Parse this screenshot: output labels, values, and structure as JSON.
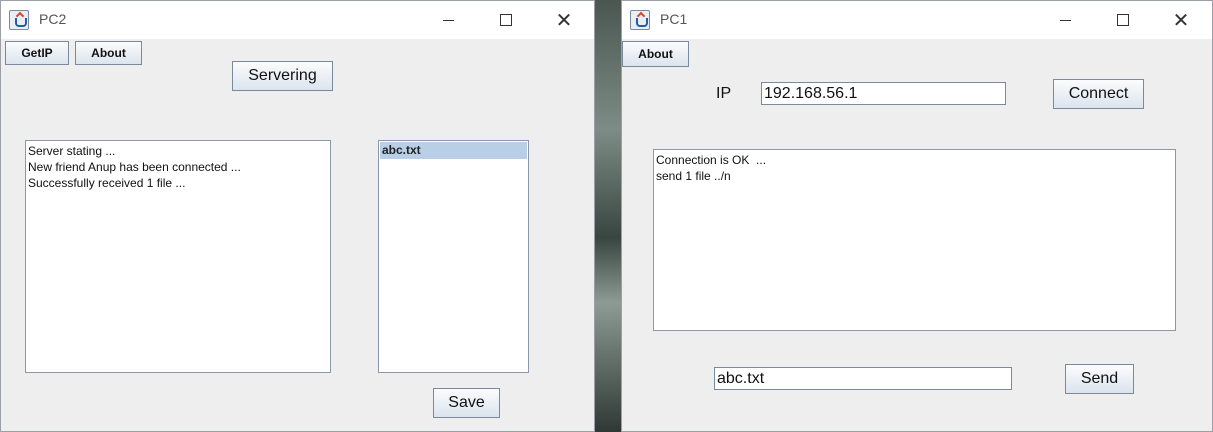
{
  "pc2": {
    "title": "PC2",
    "getip_label": "GetIP",
    "about_label": "About",
    "servering_label": "Servering",
    "log_lines": [
      "Server stating ...",
      "New friend Anup has been connected ...",
      "Successfully received 1 file ..."
    ],
    "files": [
      "abc.txt"
    ],
    "save_label": "Save"
  },
  "pc1": {
    "title": "PC1",
    "about_label": "About",
    "ip_label": "IP",
    "ip_value": "192.168.56.1",
    "connect_label": "Connect",
    "log_lines": [
      "Connection is OK  ...",
      "send 1 file ../n"
    ],
    "file_value": "abc.txt",
    "send_label": "Send"
  },
  "icons": {
    "app": "java-coffee-icon",
    "minimize": "minimize-icon",
    "maximize": "maximize-icon",
    "close": "close-icon"
  }
}
